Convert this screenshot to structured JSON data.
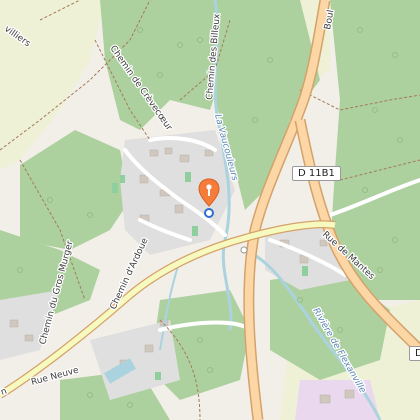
{
  "map": {
    "colors": {
      "background": "#f2efe9",
      "forest": "#add19e",
      "meadow": "#eef1d6",
      "settlement": "#e0dfdf",
      "primary_road": "#fcd6a4",
      "primary_casing": "#d4a26a",
      "water": "#aad3df",
      "marker": "#f57c3a"
    },
    "labels": {
      "chemin_des_billeux": "Chemin des Billeux",
      "chemin_de_crevecoeur": "Chemin de Crèvecœur",
      "la_vaucouleurs": "La Vaucouleurs",
      "riviere_de_flexanville": "Rivière de Flexanville",
      "rue_de_mantes": "Rue de Mantes",
      "rue_neuve": "Rue Neuve",
      "chemin_dardoue": "Chemin d'Ardoue",
      "chemin_du_gros_murger": "Chemin du Gros Murger",
      "boulevard_partial": "Boul",
      "villiers_partial": "villiers",
      "rue_partial": "n",
      "d11b1_shield": "D 11B1",
      "d_shield_partial": "D"
    },
    "marker": {
      "icon": "map-pin-icon",
      "location_dot_icon": "location-dot-icon"
    }
  }
}
